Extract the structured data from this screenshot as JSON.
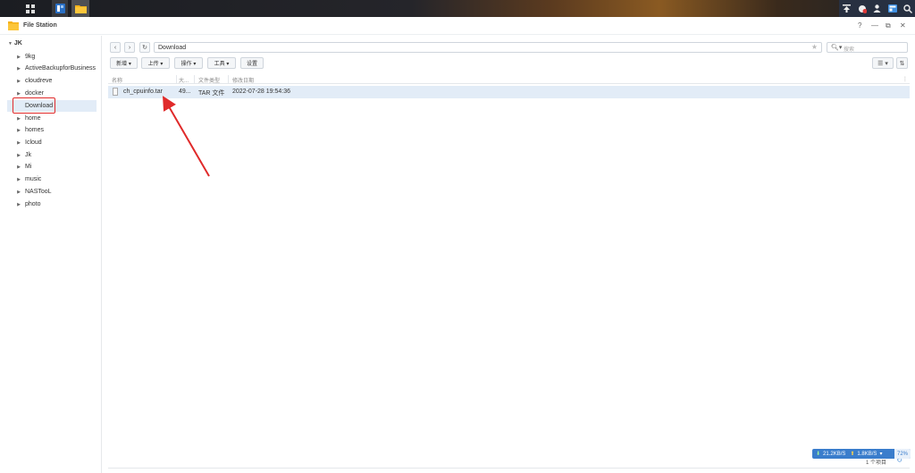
{
  "taskbar": {
    "apps": [
      "main-menu-icon",
      "package-center-icon",
      "file-station-icon"
    ],
    "right_icons": [
      "upload-icon",
      "notification-icon",
      "user-icon",
      "widgets-icon",
      "search-icon"
    ]
  },
  "window": {
    "title": "File Station",
    "controls": {
      "help": "?",
      "minimize": "—",
      "maximize": "⧉",
      "close": "✕"
    }
  },
  "sidebar": {
    "root": "JK",
    "items": [
      {
        "label": "9kg"
      },
      {
        "label": "ActiveBackupforBusiness"
      },
      {
        "label": "cloudreve"
      },
      {
        "label": "docker"
      },
      {
        "label": "Download",
        "selected": true
      },
      {
        "label": "home"
      },
      {
        "label": "homes"
      },
      {
        "label": "Icloud"
      },
      {
        "label": "Jk"
      },
      {
        "label": "Mi"
      },
      {
        "label": "music"
      },
      {
        "label": "NASTooL"
      },
      {
        "label": "photo"
      }
    ]
  },
  "toolbar": {
    "path": "Download",
    "search_placeholder": "搜索",
    "buttons": {
      "create": "新增 ▾",
      "upload": "上传 ▾",
      "action": "操作 ▾",
      "tools": "工具 ▾",
      "settings": "设置"
    }
  },
  "list": {
    "columns": [
      "名称",
      "大...",
      "文件类型",
      "修改日期"
    ],
    "rows": [
      {
        "name": "ch_cpuinfo.tar",
        "size": "49...",
        "type": "TAR 文件",
        "modified": "2022-07-28 19:54:36"
      }
    ]
  },
  "status": {
    "item_count": "1 个项目",
    "download_speed": "21.2KB/S",
    "upload_speed": "1.8KB/S",
    "percent": "72%"
  },
  "colors": {
    "selection": "#e2ecf7",
    "annotation": "#e02a2a",
    "accent": "#3a7dcc"
  }
}
